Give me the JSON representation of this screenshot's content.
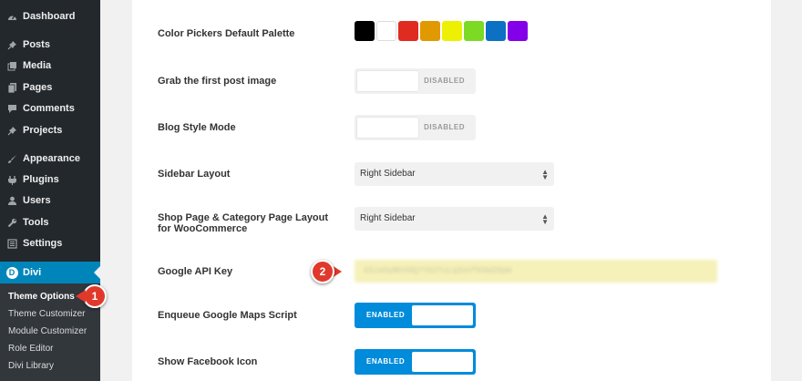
{
  "sidebar": {
    "items": [
      {
        "label": "Dashboard",
        "icon": "dashboard-icon"
      },
      {
        "label": "Posts",
        "icon": "pin-icon"
      },
      {
        "label": "Media",
        "icon": "media-icon"
      },
      {
        "label": "Pages",
        "icon": "pages-icon"
      },
      {
        "label": "Comments",
        "icon": "comments-icon"
      },
      {
        "label": "Projects",
        "icon": "pin-icon"
      },
      {
        "label": "Appearance",
        "icon": "brush-icon"
      },
      {
        "label": "Plugins",
        "icon": "plugin-icon"
      },
      {
        "label": "Users",
        "icon": "users-icon"
      },
      {
        "label": "Tools",
        "icon": "wrench-icon"
      },
      {
        "label": "Settings",
        "icon": "settings-icon"
      }
    ],
    "active": {
      "label": "Divi",
      "icon_letter": "D"
    },
    "submenu": [
      "Theme Options",
      "Theme Customizer",
      "Module Customizer",
      "Role Editor",
      "Divi Library"
    ]
  },
  "options": {
    "palette": {
      "label": "Color Pickers Default Palette",
      "colors": [
        "#000000",
        "#ffffff",
        "#e02b20",
        "#e09900",
        "#edf000",
        "#7cda24",
        "#0c71c3",
        "#8300e9"
      ]
    },
    "first_image": {
      "label": "Grab the first post image",
      "state": "DISABLED"
    },
    "blog_style": {
      "label": "Blog Style Mode",
      "state": "DISABLED"
    },
    "sidebar_layout": {
      "label": "Sidebar Layout",
      "value": "Right Sidebar"
    },
    "shop_layout": {
      "label": "Shop Page & Category Page Layout for WooCommerce",
      "value": "Right Sidebar"
    },
    "api_key": {
      "label": "Google API Key",
      "value": "AIzaSyBhX9Q7Yb2TuLq3sVfK5mZ0pW"
    },
    "maps_script": {
      "label": "Enqueue Google Maps Script",
      "state": "ENABLED"
    },
    "facebook_icon": {
      "label": "Show Facebook Icon",
      "state": "ENABLED"
    }
  },
  "callouts": {
    "first": "1",
    "second": "2"
  }
}
